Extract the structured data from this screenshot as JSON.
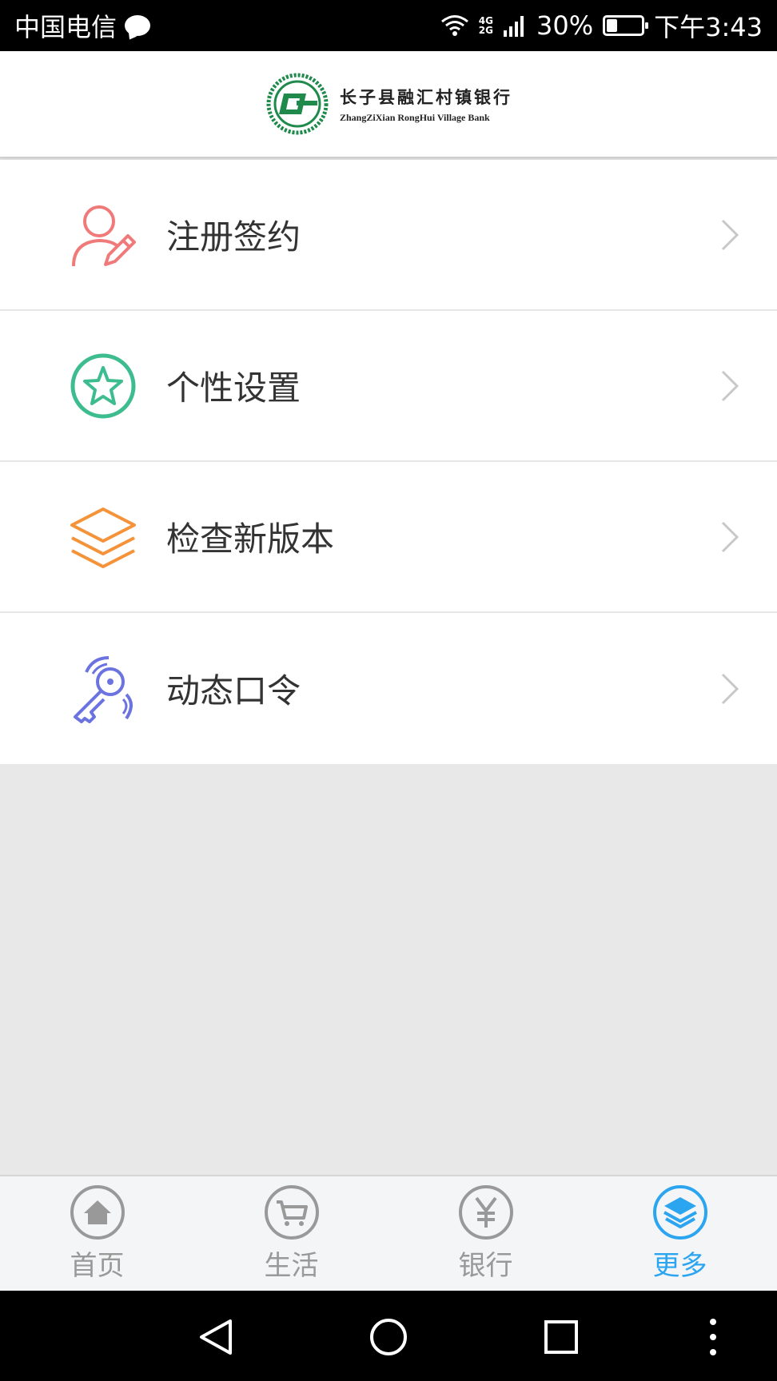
{
  "status_bar": {
    "carrier": "中国电信",
    "network_top": "4G",
    "network_bottom": "2G",
    "battery": "30%",
    "battery_level": 0.3,
    "time": "下午3:43"
  },
  "header": {
    "bank_name_cn": "长子县融汇村镇银行",
    "bank_name_en": "ZhangZiXian RongHui Village Bank"
  },
  "menu": {
    "items": [
      {
        "label": "注册签约",
        "icon": "user-edit-icon",
        "color": "#f07a7a"
      },
      {
        "label": "个性设置",
        "icon": "star-circle-icon",
        "color": "#3dbd8f"
      },
      {
        "label": "检查新版本",
        "icon": "layers-icon",
        "color": "#f4933a"
      },
      {
        "label": "动态口令",
        "icon": "key-icon",
        "color": "#6b73e0"
      }
    ]
  },
  "tabs": [
    {
      "label": "首页",
      "icon": "home-icon",
      "active": false
    },
    {
      "label": "生活",
      "icon": "cart-icon",
      "active": false
    },
    {
      "label": "银行",
      "icon": "yen-icon",
      "active": false
    },
    {
      "label": "更多",
      "icon": "layers-icon",
      "active": true
    }
  ],
  "colors": {
    "accent": "#2ca5f0",
    "inactive": "#999999",
    "logo_green": "#1f8a4c"
  }
}
